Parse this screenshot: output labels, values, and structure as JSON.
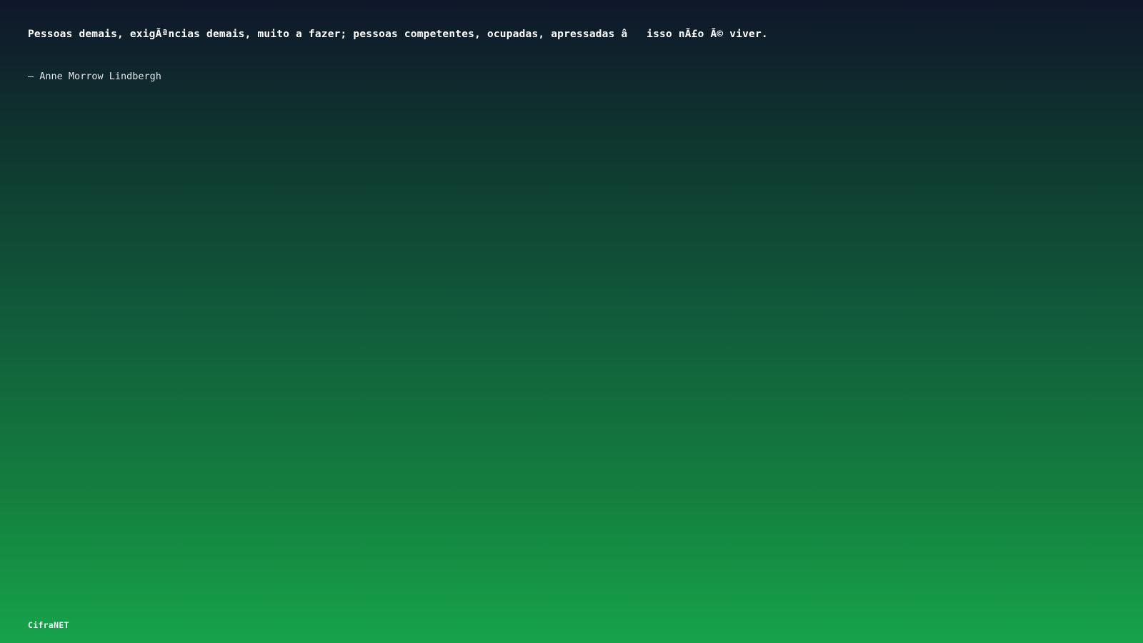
{
  "quote": {
    "text": "Pessoas demais, exigÃªncias demais, muito a fazer; pessoas competentes, ocupadas, apressadas â   isso nÃ£o Ã© viver.",
    "author": "– Anne Morrow Lindbergh"
  },
  "footer": {
    "brand": "CifraNET"
  },
  "colors": {
    "gradient_top": "#0f172a",
    "gradient_bottom": "#16a34a",
    "text": "#ffffff"
  }
}
